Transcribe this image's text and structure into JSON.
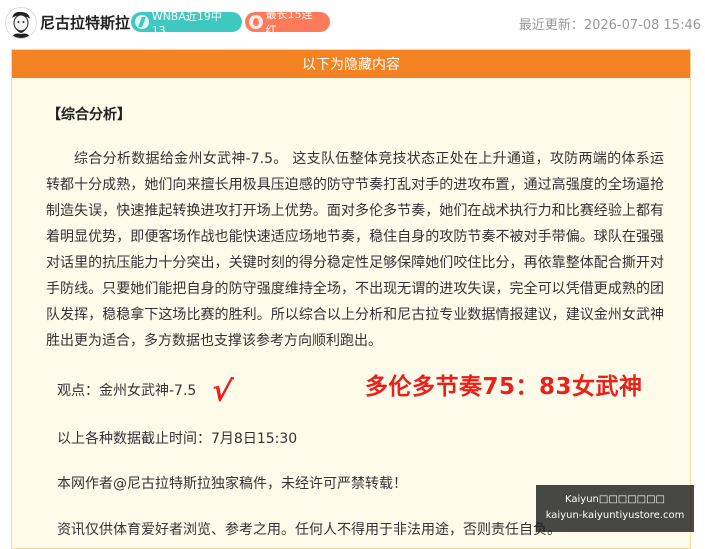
{
  "header": {
    "author": "尼古拉特斯拉",
    "badges": [
      {
        "label": "WNBA近19中13",
        "color": "#3ec9c0",
        "icon": "basketball-icon"
      },
      {
        "label": "最长15连红",
        "color": "#ff7a5a",
        "icon": "flame-icon"
      }
    ],
    "last_updated": "最近更新：2026-07-08 15:46"
  },
  "panel": {
    "header": "以下为隐藏内容",
    "section_title": "【综合分析】",
    "analysis": "综合分析数据给金州女武神-7.5。 这支队伍整体竞技状态正处在上升通道，攻防两端的体系运转都十分成熟，她们向来擅长用极具压迫感的防守节奏打乱对手的进攻布置，通过高强度的全场逼抢制造失误，快速推起转换进攻打开场上优势。面对多伦多节奏，她们在战术执行力和比赛经验上都有着明显优势，即便客场作战也能快速适应场地节奏，稳住自身的攻防节奏不被对手带偏。球队在强强对话里的抗压能力十分突出，关键时刻的得分稳定性足够保障她们咬住比分，再依靠整体配合撕开对手防线。只要她们能把自身的防守强度维持全场，不出现无谓的进攻失误，完全可以凭借更成熟的团队发挥，稳稳拿下这场比赛的胜利。所以综合以上分析和尼古拉专业数据情报建议，建议金州女武神胜出更为适合，多方数据也支撑该参考方向顺利跑出。",
    "viewpoint": "观点：金州女武神-7.5",
    "check_mark": "√",
    "score": "多伦多节奏75：83女武神",
    "deadline": "以上各种数据截止时间：7月8日15:30",
    "copyright": "本网作者@尼古拉特斯拉独家稿件，未经许可严禁转载！",
    "disclaimer": "资讯仅供体育爱好者浏览、参考之用。任何人不得用于非法用途，否则责任自负。"
  },
  "watermark": {
    "line1": "Kaiyun□□□□□□□",
    "line2": "kaiyun-kaiyuntiyustore.com"
  }
}
